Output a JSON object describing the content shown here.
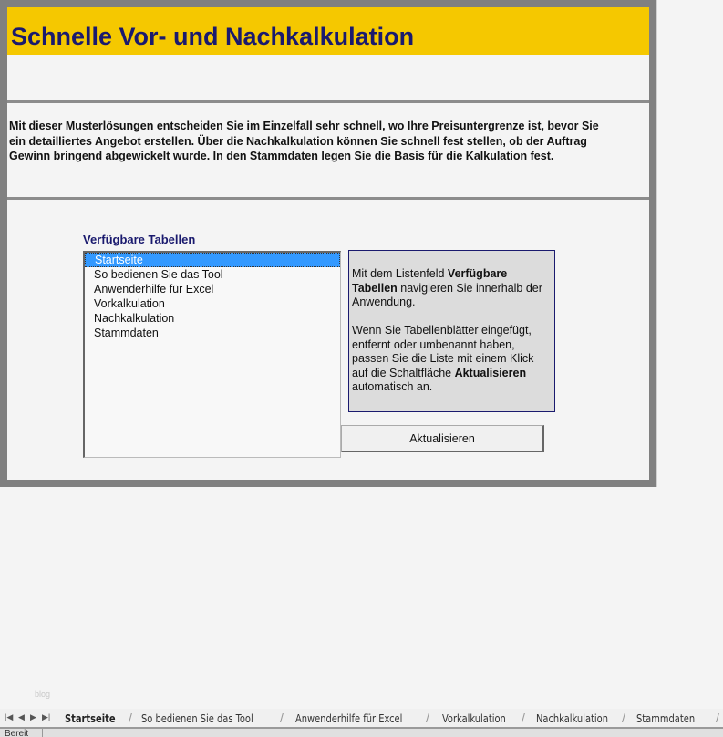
{
  "title": "Schnelle Vor- und Nachkalkulation",
  "description_lines": [
    "Mit dieser Musterlösungen  entscheiden  Sie im Einzelfall sehr schnell,  wo Ihre Preisuntergrenze ist,  bevor Sie",
    "ein detailliertes Angebot erstellen. Über die Nachkalkulation können Sie schnell fest  stellen, ob der Auftrag",
    "Gewinn bringend abgewickelt wurde. In den Stammdaten legen Sie die Basis für die Kalkulation fest."
  ],
  "list": {
    "label": "Verfügbare Tabellen",
    "items": [
      "Startseite",
      "So bedienen Sie das Tool",
      "Anwenderhilfe für Excel",
      "Vorkalkulation",
      "Nachkalkulation",
      "Stammdaten"
    ],
    "selected": "Startseite"
  },
  "help": {
    "p1_a": "Mit dem Listenfeld ",
    "p1_b": "Verfügbare Tabellen",
    "p1_c": " navigieren  Sie innerhalb der Anwendung.",
    "p2_a": "Wenn Sie Tabellenblätter  eingefügt, entfernt  oder umbenannt  haben, passen Sie die Liste mit einem Klick auf die Schaltfläche ",
    "p2_b": "Aktualisieren",
    "p2_c": " automatisch an."
  },
  "button": "Aktualisieren",
  "watermark": "blog",
  "sheet_tabs": [
    "Startseite",
    "So bedienen Sie das Tool",
    "Anwenderhilfe für Excel",
    "Vorkalkulation",
    "Nachkalkulation",
    "Stammdaten"
  ],
  "status": "Bereit"
}
